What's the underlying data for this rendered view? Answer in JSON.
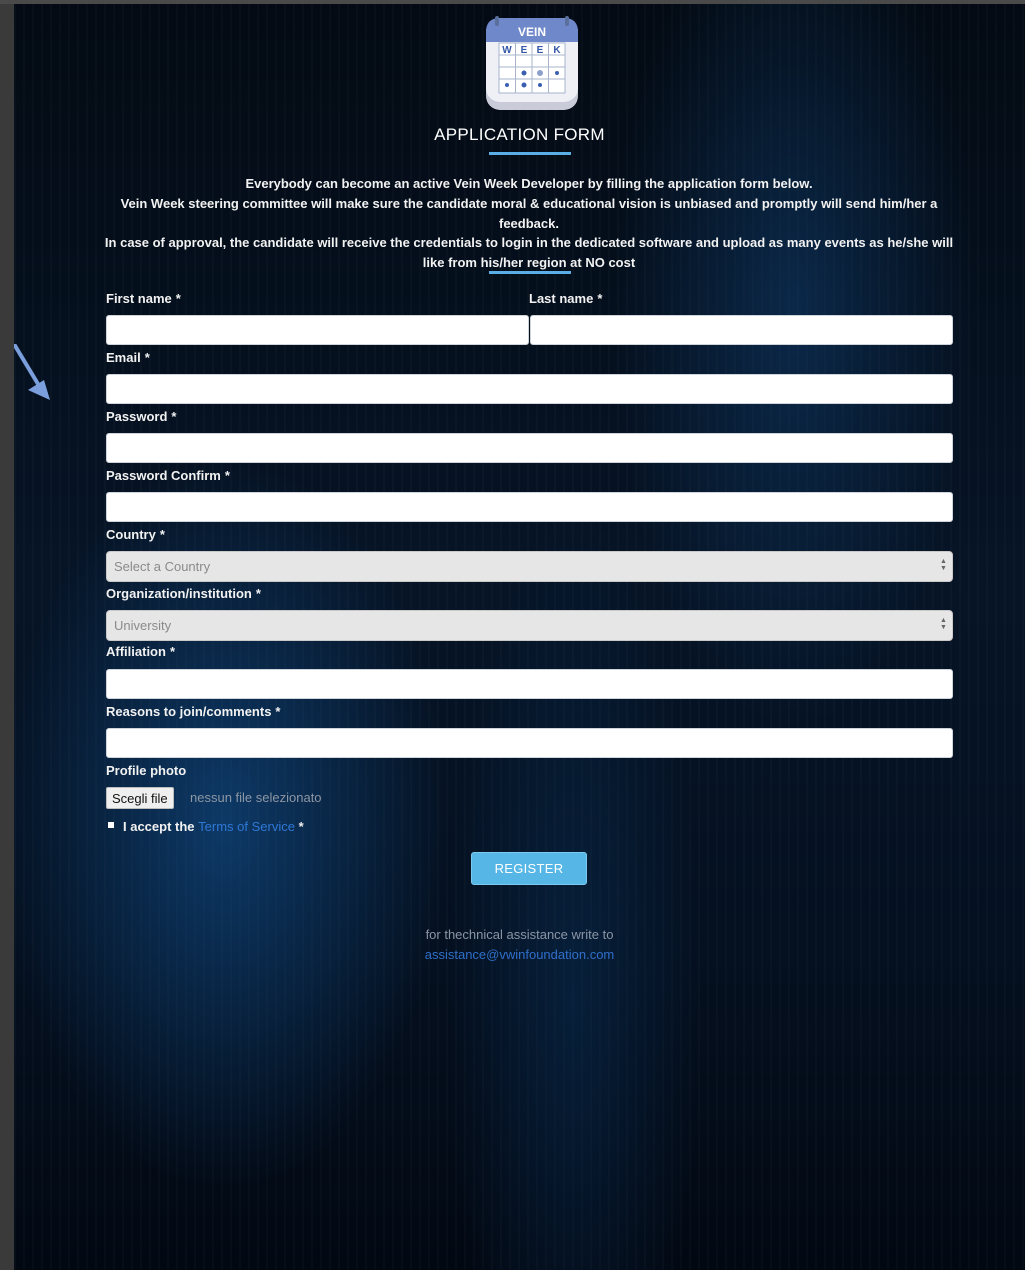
{
  "header": {
    "logo": {
      "top_word": "VEIN",
      "bottom_word_letters": [
        "W",
        "E",
        "E",
        "K"
      ],
      "icon_name": "vein-week-calendar-logo"
    },
    "title": "APPLICATION FORM"
  },
  "intro": {
    "line1": "Everybody can become an active Vein Week Developer by filling the application form below.",
    "line2": "Vein Week steering committee will make sure the candidate moral & educational vision is unbiased and promptly will send him/her a feedback.",
    "line3": "In case of approval, the candidate will receive the credentials to login in the dedicated software and upload as many events as he/she will like from his/her region at NO cost"
  },
  "form": {
    "required_marker": "*",
    "first_name_label": "First name",
    "last_name_label": "Last name",
    "email_label": "Email",
    "password_label": "Password",
    "password_confirm_label": "Password Confirm",
    "country_label": "Country",
    "country_placeholder": "Select a Country",
    "organization_label": "Organization/institution",
    "organization_value": "University",
    "affiliation_label": "Affiliation",
    "reasons_label": "Reasons to join/comments",
    "profile_photo_label": "Profile photo",
    "file_button": "Scegli file",
    "file_status": "nessun file selezionato",
    "terms_prefix": "I accept the",
    "terms_link": "Terms of Service",
    "register_button": "REGISTER"
  },
  "footer": {
    "assistance_text": "for thechnical assistance write to",
    "assistance_email": "assistance@vwinfoundation.com"
  },
  "colors": {
    "accent": "#56b7e6",
    "underline": "#5aaee6",
    "link": "#2f78d6",
    "background_dark": "#061426"
  },
  "annotation": {
    "arrow_icon": "arrow-pointer-icon"
  }
}
